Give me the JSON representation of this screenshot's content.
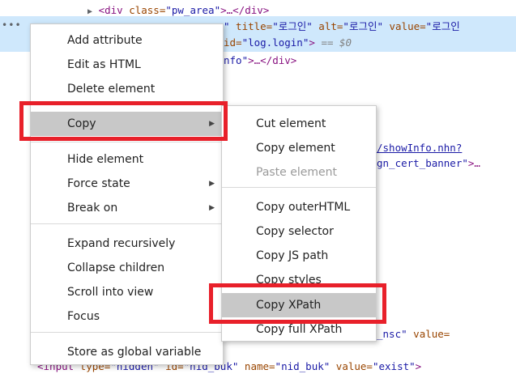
{
  "code_lines": {
    "l1_tag_open": "<div ",
    "l1_attr": "class=",
    "l1_val": "\"pw_area\"",
    "l1_rest": ">…</div>",
    "l2_val_tail": "\"",
    "l2_attr_title": " title=",
    "l2_val_title": "\"로그인\"",
    "l2_attr_alt": " alt=",
    "l2_val_alt": "\"로그인\"",
    "l2_attr_value": " value=",
    "l2_val_value": "\"로그인",
    "l3_frag": "id=",
    "l3_val": "\"log.login\"",
    "l3_rest": "> ",
    "l3_dollar": "== $0",
    "l4_frag": "nfo\"",
    "l4_rest": ">…</div>",
    "r1_link": "/showInfo.nhn?",
    "r2_val": "gn_cert_banner\"",
    "r2_rest": ">…",
    "r3_frag": "_nsc\"",
    "r3_attr": " value=",
    "last_tag": "<input ",
    "last_attr_type": "type=",
    "last_val_type": "\"hidden\"",
    "last_attr_id": " id=",
    "last_val_id": "\"nid_buk\"",
    "last_attr_name": " name=",
    "last_val_name": "\"nid_buk\"",
    "last_attr_value": " value=",
    "last_val_value": "\"exist\"",
    "last_close": ">",
    "ellipsis": "•••"
  },
  "main_menu": {
    "items": [
      {
        "label": "Add attribute"
      },
      {
        "label": "Edit as HTML"
      },
      {
        "label": "Delete element"
      },
      {
        "label": "Copy",
        "highlighted": true,
        "submenu": true
      },
      {
        "label": "Hide element"
      },
      {
        "label": "Force state",
        "submenu": true
      },
      {
        "label": "Break on",
        "submenu": true
      },
      {
        "label": "Expand recursively"
      },
      {
        "label": "Collapse children"
      },
      {
        "label": "Scroll into view"
      },
      {
        "label": "Focus"
      },
      {
        "label": "Store as global variable"
      }
    ],
    "arrow_glyph": "▶"
  },
  "copy_submenu": {
    "items": [
      {
        "label": "Cut element"
      },
      {
        "label": "Copy element"
      },
      {
        "label": "Paste element",
        "disabled": true
      },
      {
        "label": "Copy outerHTML"
      },
      {
        "label": "Copy selector"
      },
      {
        "label": "Copy JS path"
      },
      {
        "label": "Copy styles"
      },
      {
        "label": "Copy XPath",
        "highlighted": true
      },
      {
        "label": "Copy full XPath"
      }
    ]
  },
  "colors": {
    "highlight_box": "#e8202a",
    "menu_hover": "#c8c8c8",
    "selected_row": "#cfe8fc"
  }
}
